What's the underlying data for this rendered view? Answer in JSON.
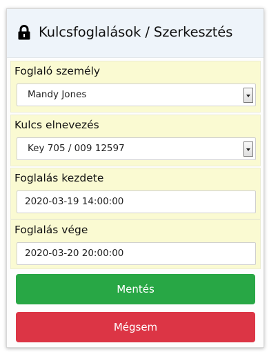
{
  "header": {
    "title": "Kulcsfoglalások / Szerkesztés",
    "icon": "lock-icon"
  },
  "form": {
    "person": {
      "label": "Foglaló személy",
      "value": "Mandy Jones"
    },
    "key_name": {
      "label": "Kulcs elnevezés",
      "value": "Key 705 / 009 12597"
    },
    "start": {
      "label": "Foglalás kezdete",
      "value": "2020-03-19 14:00:00"
    },
    "end": {
      "label": "Foglalás vége",
      "value": "2020-03-20 20:00:00"
    }
  },
  "buttons": {
    "save_label": "Mentés",
    "cancel_label": "Mégsem"
  },
  "colors": {
    "section_background": "#fafad2",
    "header_background": "#eef4fa",
    "save": "#28a745",
    "cancel": "#dc3545"
  }
}
